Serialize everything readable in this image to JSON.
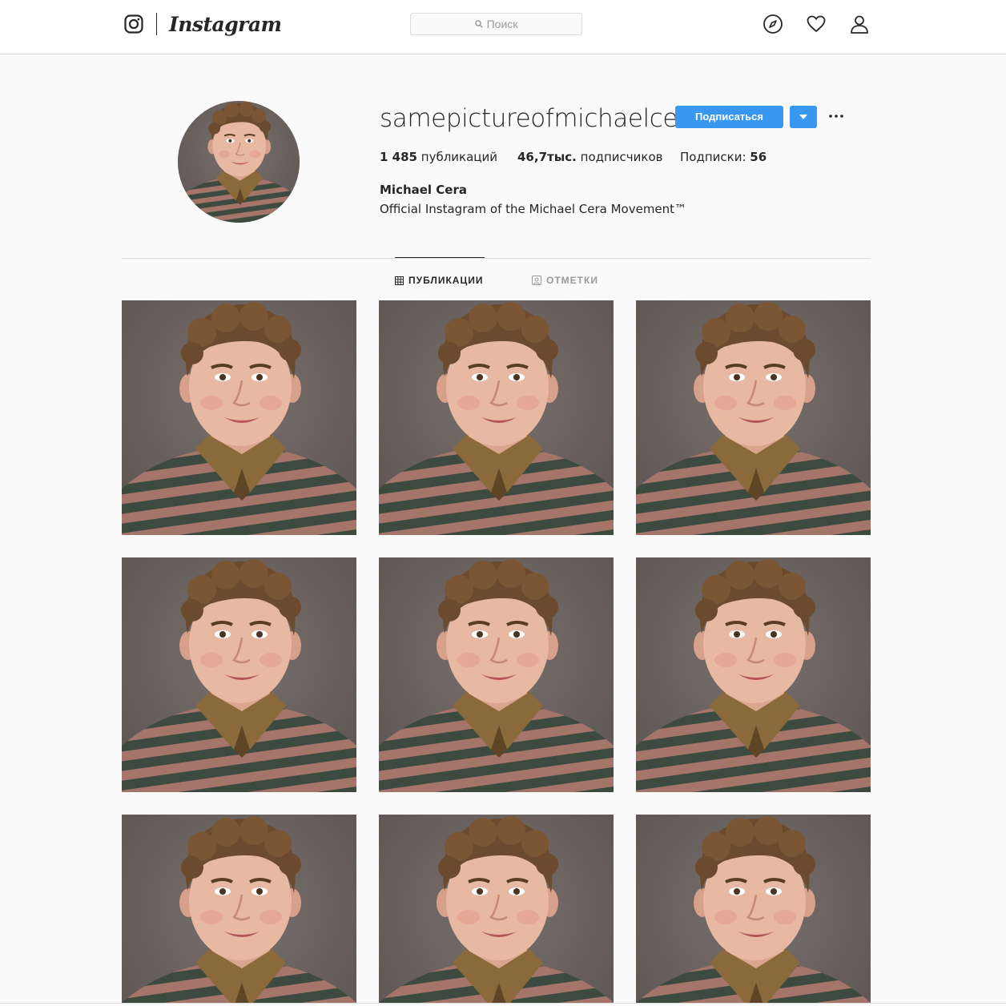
{
  "nav": {
    "wordmark": "Instagram",
    "search_placeholder": "Поиск",
    "icons": [
      "instagram-glyph-icon",
      "search-icon",
      "compass-icon",
      "heart-icon",
      "profile-icon"
    ]
  },
  "profile": {
    "username": "samepictureofmichaelcera",
    "follow_label": "Подписаться",
    "stats": {
      "posts_count": "1 485",
      "posts_label": "публикаций",
      "followers_count": "46,7тыс.",
      "followers_label": "подписчиков",
      "following_label": "Подписки:",
      "following_count": "56"
    },
    "full_name": "Michael Cera",
    "bio": "Official Instagram of the Michael Cera Movement™"
  },
  "tabs": [
    {
      "label": "ПУБЛИКАЦИИ",
      "icon": "grid-icon",
      "active": true
    },
    {
      "label": "ОТМЕТКИ",
      "icon": "tagged-icon",
      "active": false
    }
  ],
  "posts_visible": 9,
  "colors": {
    "accent": "#3897f0",
    "background": "#fafafa",
    "text": "#262626",
    "muted": "#999999",
    "border": "#dbdbdb"
  }
}
